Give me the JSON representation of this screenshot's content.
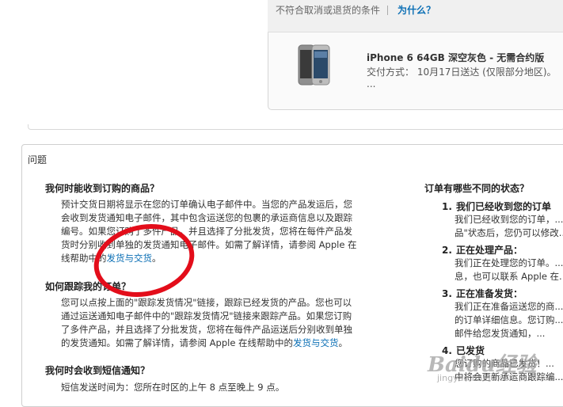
{
  "top": {
    "note": "不符合取消或退货的条件",
    "why_link": "为什么？",
    "product_name": "iPhone 6 64GB 深空灰色 - 无需合约版",
    "shipping": "交付方式： 10月17日送达 (仅限部分地区)。 ...",
    "product_image": "iphone-icon"
  },
  "questions": {
    "header": "问题",
    "q1": {
      "title": "我何时能收到订购的商品？",
      "lines": [
        "预计交货日期将显示在您的订单确认电子邮件中。当您的产品发运后，您",
        "会收到发货通知电子邮件，其中包含运送您的包裹的承运商信息以及跟踪",
        "编号。如果您订购了多件产品，并且选择了分批发货，您将在每件产品发",
        "货时分别收到单独的发货通知电子邮件。如需了解详情，请参阅 Apple 在",
        "线帮助中的"
      ],
      "link": "发货与交货",
      "end": "。"
    },
    "q2": {
      "title": "如何跟踪我的订单？",
      "lines": [
        "您可以点按上面的\"跟踪发货情况\"链接，跟踪已经发货的产品。您也可以",
        "通过运送通知电子邮件中的\"跟踪发货情况\"链接来跟踪产品。如果您订购",
        "了多件产品，并且选择了分批发货，您将在每件产品运送后分别收到单独",
        "的发货通知。如需了解详情，请参阅 Apple 在线帮助中的"
      ],
      "link": "发货与交货",
      "end": "。"
    },
    "q3": {
      "title": "我何时会收到短信通知？",
      "line": "短信发送时间为：您所在时区的上午 8 点至晚上 9 点。"
    },
    "status": {
      "title": "订单有哪些不同的状态？",
      "items": [
        {
          "num": "1.",
          "title": "我们已经收到您的订单",
          "lines": [
            "我们已经收到您的订单，...",
            "品\"状态后，您仍可以修改..."
          ]
        },
        {
          "num": "2.",
          "title": "正在处理产品：",
          "lines": [
            "我们正在处理您的订单。...",
            "息，也可以联系 Apple 在..."
          ]
        },
        {
          "num": "3.",
          "title": "正在准备发货：",
          "lines": [
            "我们正在准备运送您的商...",
            "的订单详细信息。您订购...",
            "邮件给您发货通知，..."
          ]
        },
        {
          "num": "4.",
          "title": "已发货",
          "lines": [
            "您订购的商品已发货！...",
            "中将会更新承运商跟踪编..."
          ]
        }
      ]
    }
  },
  "watermark": {
    "brand": "Baidu经验",
    "sub": "jingyan.baidu.com"
  },
  "colors": {
    "link": "#0b6fb5",
    "annotation": "#e30d1a"
  }
}
